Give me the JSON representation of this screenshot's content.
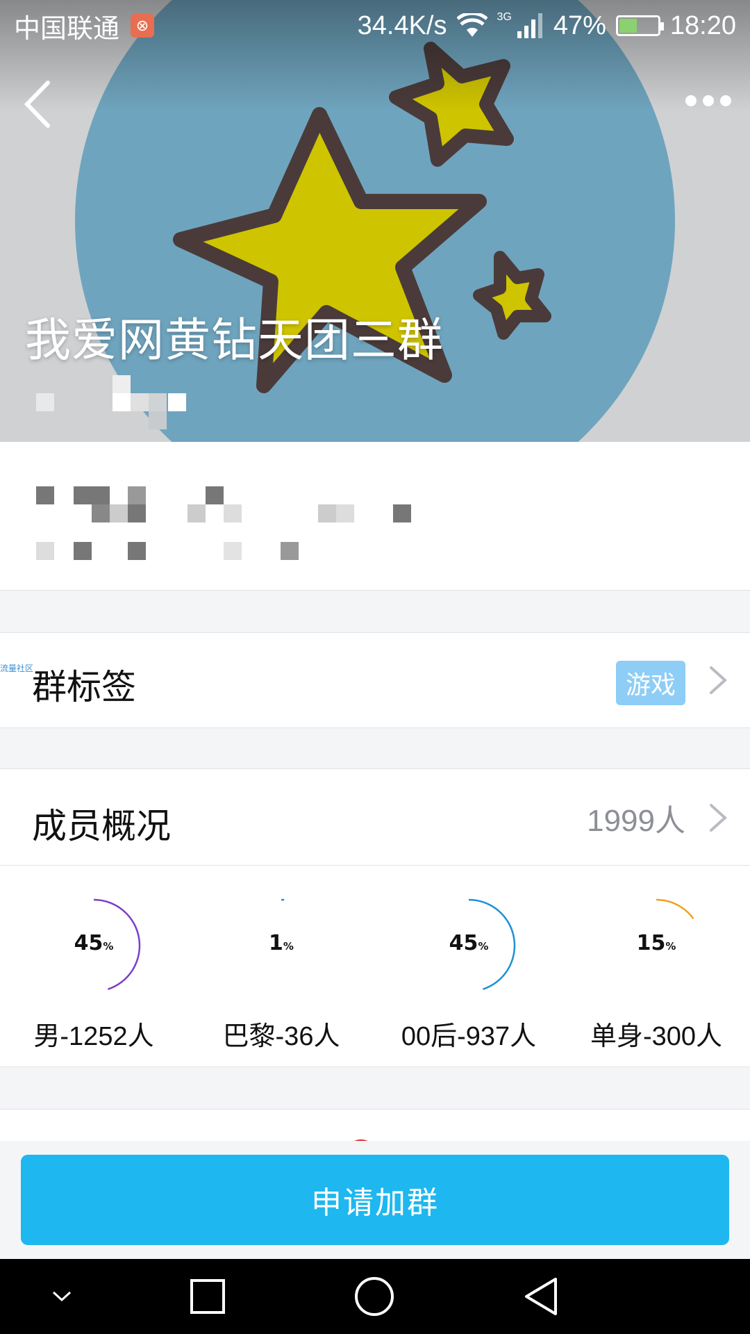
{
  "status_bar": {
    "carrier": "中国联通",
    "speed": "34.4K/s",
    "network": "3G",
    "battery_percent": "47%",
    "battery_level": 0.47,
    "time": "18:20"
  },
  "header": {
    "group_name": "我爱网黄钻天团三群"
  },
  "tags_row": {
    "title": "群标签",
    "tag": "游戏"
  },
  "members_row": {
    "title": "成员概况",
    "count": "1999人"
  },
  "stats": [
    {
      "pct": "45",
      "unit": "%",
      "label": "男-1252人",
      "fraction": 0.45,
      "color": "#7b3fc8"
    },
    {
      "pct": "1",
      "unit": "%",
      "label": "巴黎-36人",
      "fraction": 0.01,
      "color": "#1e90d6"
    },
    {
      "pct": "45",
      "unit": "%",
      "label": "00后-937人",
      "fraction": 0.45,
      "color": "#1e90d6"
    },
    {
      "pct": "15",
      "unit": "%",
      "label": "单身-300人",
      "fraction": 0.15,
      "color": "#f0a020"
    }
  ],
  "watermark": "流量社区",
  "action": {
    "join_label": "申请加群"
  }
}
